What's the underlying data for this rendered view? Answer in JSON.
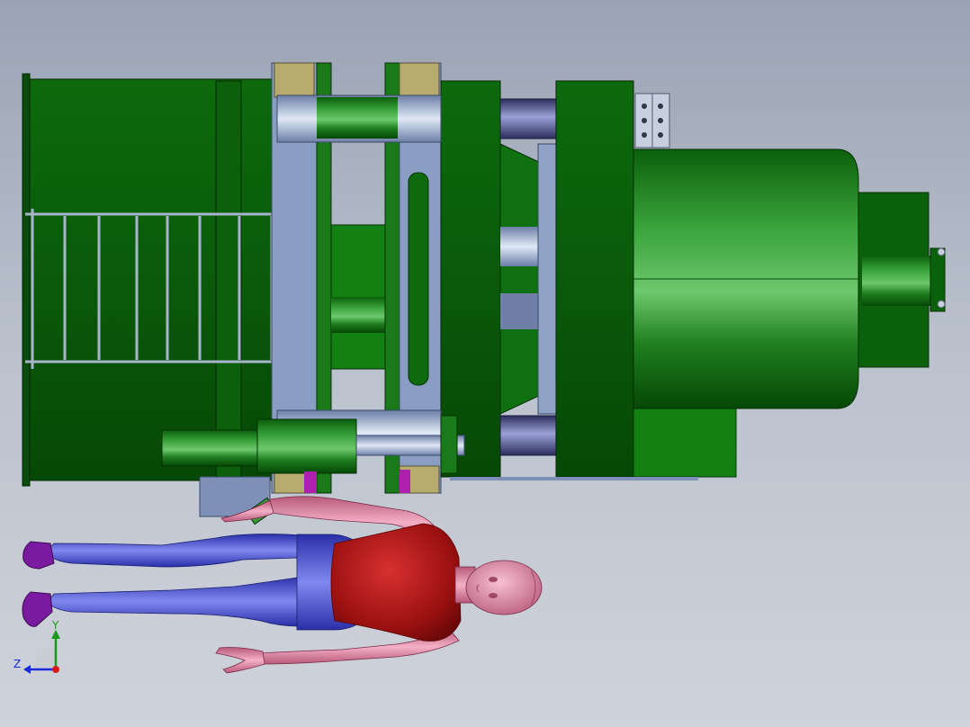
{
  "view": {
    "background_top": "#9aa3b4",
    "background_bottom": "#cfd3db"
  },
  "machine": {
    "primary_color": "#0a5a0a",
    "dark_color": "#054405",
    "light_color": "#3f9a3f",
    "steel_color": "#8fa3c6",
    "tie_bar_color": "#5a5f8c"
  },
  "mannequin": {
    "shirt_color": "#b01818",
    "pants_color": "#5a62e0",
    "skin_color": "#e48aa8",
    "shoe_color": "#7a1aa0"
  },
  "triad": {
    "y_label": "Y",
    "z_label": "Z",
    "y_color": "#1a9a1a",
    "z_color": "#1a2ad8",
    "x_color": "#d81a1a"
  }
}
